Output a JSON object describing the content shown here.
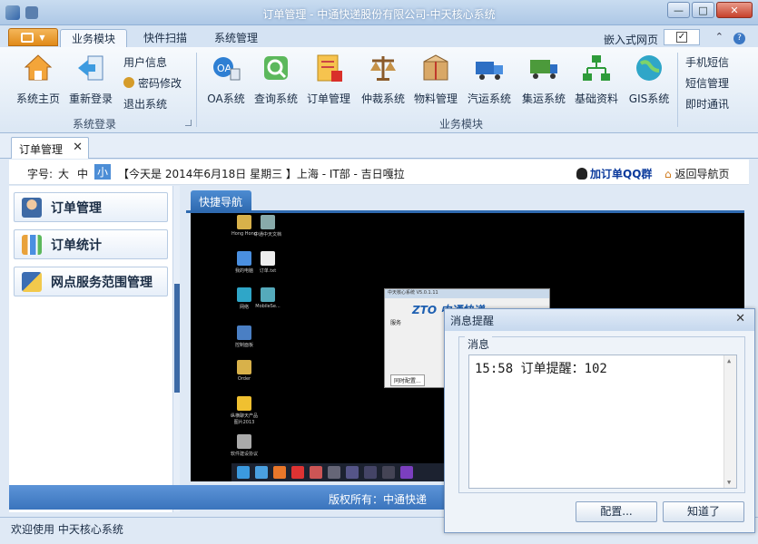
{
  "window": {
    "title": "订单管理 - 中通快递股份有限公司-中天核心系统"
  },
  "ribbon_tabs": [
    {
      "label": "业务模块",
      "active": true
    },
    {
      "label": "快件扫描",
      "active": false
    },
    {
      "label": "系统管理",
      "active": false
    }
  ],
  "embed": {
    "label": "嵌入式网页",
    "checked": true,
    "check_mark": "✓"
  },
  "ribbon": {
    "group_login": {
      "label": "系统登录",
      "home_label": "系统主页",
      "relogin_label": "重新登录",
      "user_info_label": "用户信息",
      "password_label": "密码修改",
      "logout_label": "退出系统"
    },
    "group_business": {
      "label": "业务模块",
      "buttons": [
        {
          "label": "OA系统",
          "icon": "oa-icon"
        },
        {
          "label": "查询系统",
          "icon": "query-icon"
        },
        {
          "label": "订单管理",
          "icon": "order-icon"
        },
        {
          "label": "仲裁系统",
          "icon": "scales-icon"
        },
        {
          "label": "物料管理",
          "icon": "package-icon"
        },
        {
          "label": "汽运系统",
          "icon": "truck-icon"
        },
        {
          "label": "集运系统",
          "icon": "container-truck-icon"
        },
        {
          "label": "基础资料",
          "icon": "org-chart-icon"
        },
        {
          "label": "GIS系统",
          "icon": "globe-icon"
        }
      ],
      "sms_label": "手机短信",
      "sms_manage_label": "短信管理",
      "im_label": "即时通讯"
    }
  },
  "doc_tab": {
    "label": "订单管理",
    "close": "✕"
  },
  "infobar": {
    "font_label": "字号:",
    "size_large": "大",
    "size_medium": "中",
    "size_small": "小",
    "date_text": "【今天是 2014年6月18日 星期三 】上海 - IT部 - 吉日嘎拉",
    "qq_label": "加订单QQ群",
    "back_label": "返回导航页"
  },
  "leftnav": [
    {
      "label": "订单管理",
      "icon": "person-icon"
    },
    {
      "label": "订单统计",
      "icon": "chart-icon"
    },
    {
      "label": "网点服务范围管理",
      "icon": "book-icon"
    }
  ],
  "quicknav": {
    "label": "快捷导航"
  },
  "desktop": {
    "icons": [
      "Hong Hong",
      "中通中天文档",
      "我的电脑",
      "订单.txt",
      "网络",
      "MobileSe...",
      "控制面板",
      "Order",
      "纵横聊天产品图片2013",
      "软件建设协议"
    ],
    "mini_window_title": "中天核心系统 V5.0.1.11",
    "mini_logo": "ZTO 中通快递",
    "mini_label": "服务",
    "mini_button": "同时配置..."
  },
  "footer": {
    "copyright": "版权所有：中通快递"
  },
  "status": {
    "text": "欢迎使用 中天核心系统"
  },
  "popup": {
    "title": "消息提醒",
    "close": "✕",
    "legend": "消息",
    "message": "15:58 订单提醒：102",
    "config_button": "配置...",
    "ok_button": "知道了"
  }
}
